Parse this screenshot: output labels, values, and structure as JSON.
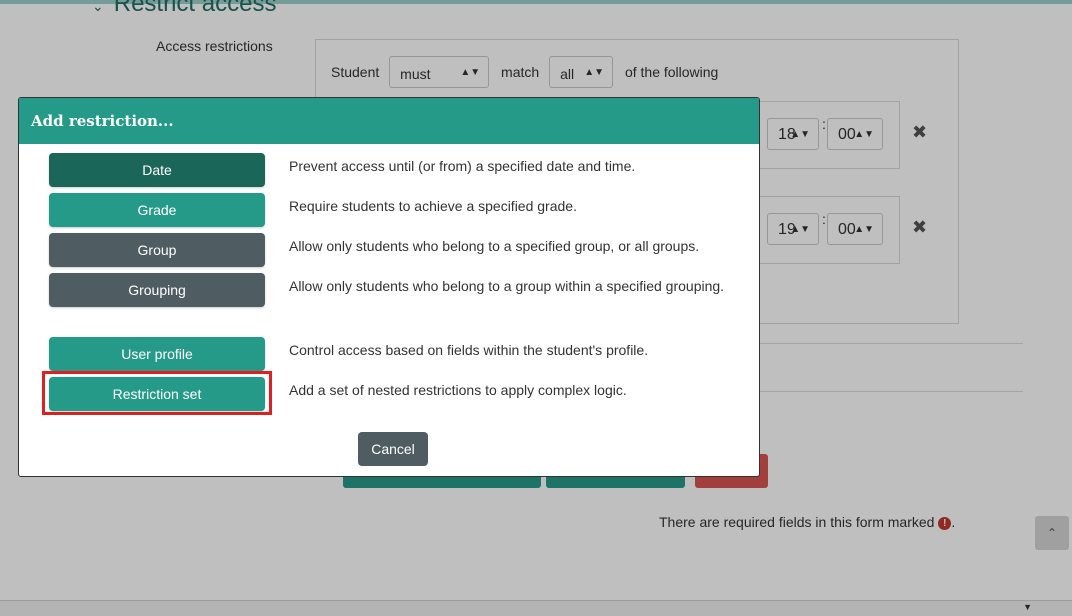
{
  "background": {
    "section_title": "Restrict access",
    "access_label": "Access restrictions",
    "student_label": "Student",
    "must_value": "must",
    "match_label": "match",
    "all_value": "all",
    "of_following": "of the following",
    "cond1": {
      "hour": "18",
      "sep": ":",
      "minute": "00"
    },
    "cond2": {
      "hour": "19",
      "sep": ":",
      "minute": "00"
    },
    "required_note": "There are required fields in this form marked",
    "period": "."
  },
  "modal": {
    "title": "Add restriction...",
    "items": [
      {
        "label": "Date",
        "desc": "Prevent access until (or from) a specified date and time.",
        "color": "#1a6659"
      },
      {
        "label": "Grade",
        "desc": "Require students to achieve a specified grade.",
        "color": "#269a89"
      },
      {
        "label": "Group",
        "desc": "Allow only students who belong to a specified group, or all groups.",
        "color": "#4f5d63"
      },
      {
        "label": "Grouping",
        "desc": "Allow only students who belong to a group within a specified grouping.",
        "color": "#4f5d63"
      },
      {
        "label": "User profile",
        "desc": "Control access based on fields within the student's profile.",
        "color": "#269a89"
      },
      {
        "label": "Restriction set",
        "desc": "Add a set of nested restrictions to apply complex logic.",
        "color": "#269a89"
      }
    ],
    "cancel_label": "Cancel"
  },
  "colors": {
    "teal": "#269a89",
    "dark_teal": "#1a6659",
    "slate": "#4f5d63",
    "highlight": "#e02020"
  }
}
